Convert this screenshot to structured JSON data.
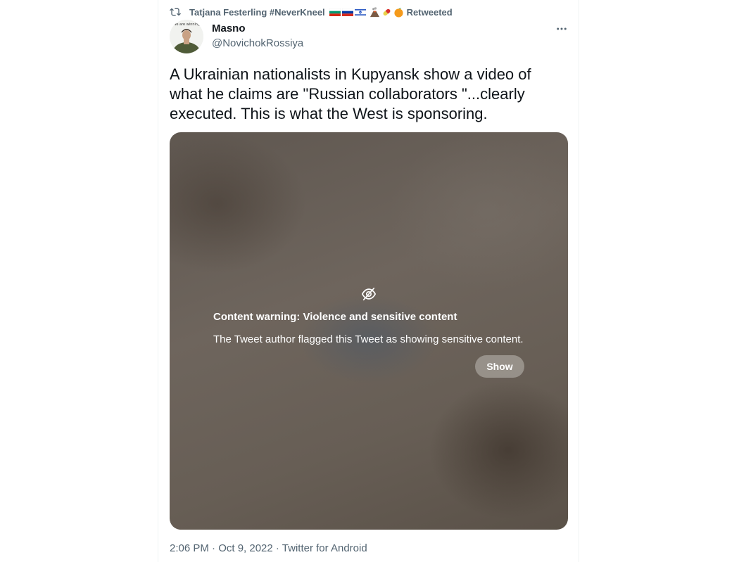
{
  "retweet": {
    "retweeter": "Tatjana Festerling #NeverKneel",
    "label": "Retweeted"
  },
  "tweet": {
    "author_name": "Masno",
    "author_handle": "@NovichokRossiya",
    "avatar_caption": "We are winning",
    "text": "A Ukrainian nationalists in Kupyansk show a video of\nwhat he claims are \"Russian collaborators \"...clearly\nexecuted.  This is what the West is sponsoring.",
    "timestamp": "2:06 PM · Oct 9, 2022 · Twitter for Android"
  },
  "media_warning": {
    "title": "Content warning: Violence and sensitive content",
    "description": "The Tweet author flagged this Tweet as showing sensitive content.",
    "show_label": "Show"
  },
  "icons": {
    "retweet": "retweet-icon",
    "more": "more-options-icon",
    "hidden": "eye-slash-icon",
    "flags": [
      "bulgaria-flag-icon",
      "russia-flag-icon",
      "israel-flag-icon"
    ],
    "emoji": [
      "volcano-emoji-icon",
      "pill-emoji-icon",
      "orange-emoji-icon"
    ]
  },
  "colors": {
    "text_primary": "#0f1419",
    "text_secondary": "#536471",
    "border": "#eff3f4"
  }
}
